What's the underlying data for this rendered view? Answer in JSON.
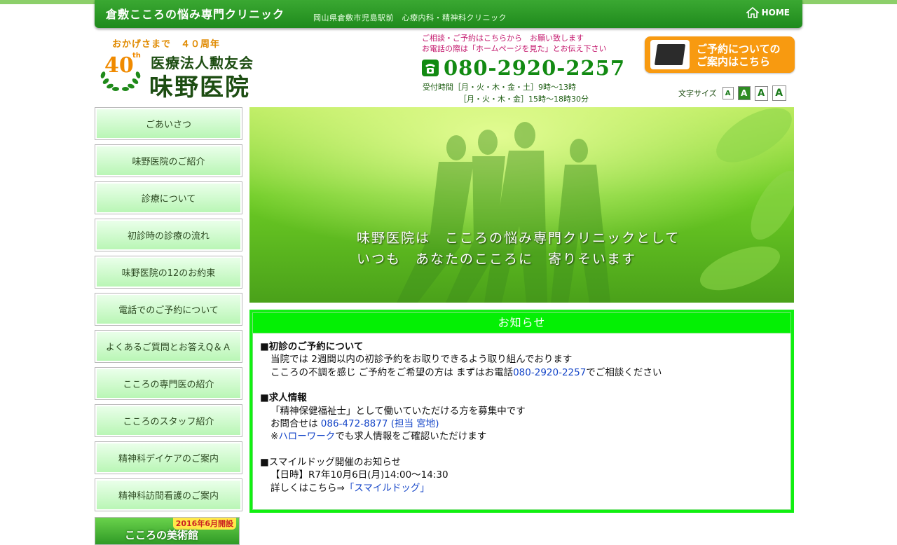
{
  "header": {
    "site_name": "倉敷こころの悩み専門クリニック",
    "subline": "岡山県倉敷市児島駅前　心療内科・精神科クリニック",
    "home_label": "HOME"
  },
  "brand": {
    "anniversary": "おかげさまで　４０周年",
    "badge_number": "40",
    "badge_suffix": "th",
    "org_name": "医療法人勲友会",
    "clinic_name": "味野医院"
  },
  "contact": {
    "note1": "ご相談・ご予約はこちらから　お願い致します",
    "note2": "お電話の際は「ホームページを見た」とお伝え下さい",
    "phone": "080-2920-2257",
    "hours1": "受付時間［月・火・木・金・土］9時〜13時",
    "hours2": "［月・火・木・金］15時〜18時30分"
  },
  "reserve_banner": {
    "line1": "ご予約についての",
    "line2": "ご案内はこちら"
  },
  "font_size": {
    "label": "文字サイズ",
    "buttons": [
      "A",
      "A",
      "A",
      "A"
    ]
  },
  "sidebar": {
    "items": [
      {
        "label": "ごあいさつ"
      },
      {
        "label": "味野医院のご紹介"
      },
      {
        "label": "診療について"
      },
      {
        "label": "初診時の診療の流れ"
      },
      {
        "label": "味野医院の12のお約束"
      },
      {
        "label": "電話でのご予約について"
      },
      {
        "label": "よくあるご質問とお答えQ＆Ａ"
      },
      {
        "label": "こころの専門医の紹介"
      },
      {
        "label": "こころのスタッフ紹介"
      },
      {
        "label": "精神科デイケアのご案内"
      },
      {
        "label": "精神科訪問看護のご案内"
      }
    ],
    "museum_badge": "2016年6月開設",
    "museum_name": "こころの美術館"
  },
  "hero": {
    "line1": "味野医院は　こころの悩み専門クリニックとして",
    "line2": "いつも　あなたのこころに　寄りそいます"
  },
  "notice": {
    "title": "お知らせ",
    "s1_title": "■初診のご予約について",
    "s1_l1": "当院では 2週間以内の初診予約をお取りできるよう取り組んでおります",
    "s1_l2_pre": "こころの不調を感じ ご予約をご希望の方は まずはお電話",
    "s1_l2_link": "080-2920-2257",
    "s1_l2_post": "でご相談ください",
    "s2_title": "■求人情報",
    "s2_l1": "「精神保健福祉士」として働いていただける方を募集中です",
    "s2_l2_pre": "お問合せは ",
    "s2_l2_link": "086-472-8877 (担当 宮地)",
    "s2_l3_pre": "※",
    "s2_l3_link": "ハローワーク",
    "s2_l3_post": "でも求人情報をご確認いただけます",
    "s3_title": "■スマイルドッグ開催のお知らせ",
    "s3_l1": "【日時】R7年10月6日(月)14:00〜14:30",
    "s3_l2_pre": "詳しくはこちら⇒",
    "s3_l2_link": "「スマイルドッグ」"
  }
}
